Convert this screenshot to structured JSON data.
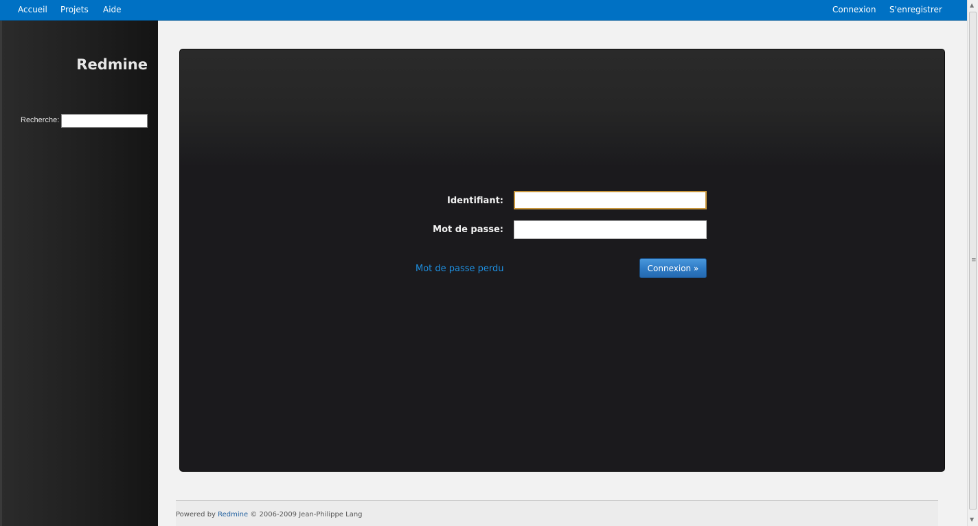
{
  "top_menu": {
    "left": [
      "Accueil",
      "Projets",
      "Aide"
    ],
    "right": [
      "Connexion",
      "S'enregistrer"
    ]
  },
  "sidebar": {
    "title": "Redmine",
    "search_label": "Recherche:",
    "search_value": ""
  },
  "login": {
    "username_label": "Identifiant:",
    "username_value": "",
    "password_label": "Mot de passe:",
    "password_value": "",
    "lost_password": "Mot de passe perdu",
    "submit": "Connexion »"
  },
  "footer": {
    "powered_by": "Powered by",
    "link": "Redmine",
    "copyright": "© 2006-2009 Jean-Philippe Lang"
  },
  "colors": {
    "top_bar": "#0071c4",
    "link": "#1e8fe0",
    "focus_border": "#c8963c",
    "button": "#2f7cc6"
  },
  "icons": {
    "scroll_up": "chevron-up-icon",
    "scroll_down": "chevron-down-icon",
    "scroll_grip": "grip-icon"
  }
}
